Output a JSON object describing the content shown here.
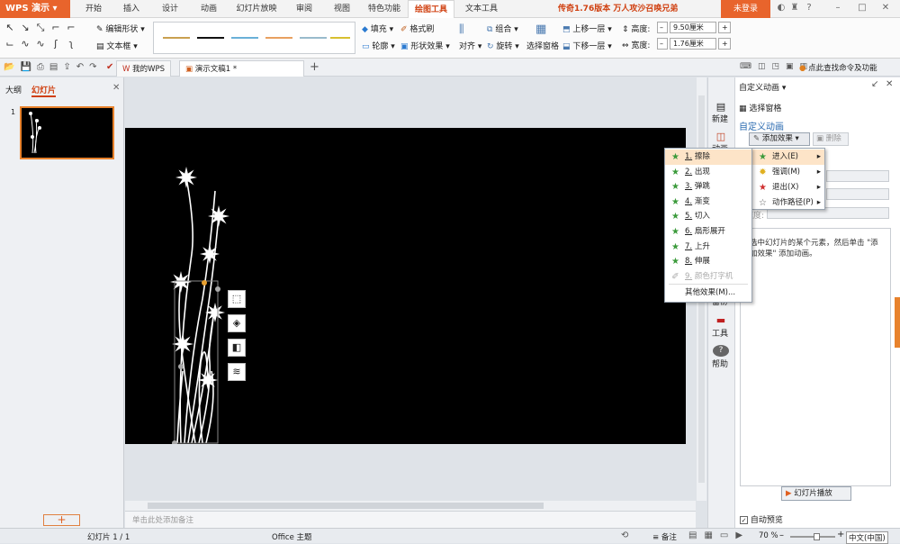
{
  "app": {
    "name": "WPS 演示",
    "login": "未登录"
  },
  "menus": [
    "开始",
    "插入",
    "设计",
    "动画",
    "幻灯片放映",
    "审阅",
    "视图",
    "特色功能",
    "绘图工具",
    "文本工具"
  ],
  "promo": "传奇1.76版本 万人攻沙召唤兄弟",
  "ribbon": {
    "edit_shape": "编辑形状",
    "text_box": "文本框",
    "fill": "填充",
    "format_brush": "格式刷",
    "outline": "轮廓",
    "shape_effect": "形状效果",
    "align": "对齐",
    "group": "组合",
    "rotate": "旋转",
    "select_pane": "选择窗格",
    "bring_forward": "上移一层",
    "send_backward": "下移一层",
    "height_label": "高度:",
    "height_value": "9.50厘米",
    "width_label": "宽度:",
    "width_value": "1.76厘米"
  },
  "tabs": {
    "my_wps": "我的WPS",
    "doc": "演示文稿1 *"
  },
  "search_hint": "点此查找命令及功能",
  "left_panel": {
    "outline": "大纲",
    "slides": "幻灯片",
    "slide_number": "1"
  },
  "strip": {
    "new": "新建",
    "anim": "动画",
    "backup": "备份",
    "tools": "工具",
    "help": "帮助"
  },
  "pane": {
    "title": "自定义动画",
    "select_pane": "选择窗格",
    "section": "自定义动画",
    "add_effect": "添加效果",
    "delete": "删除",
    "speed": "速度:",
    "hint": "选中幻灯片的某个元素，然后单击 \"添加效果\" 添加动画。",
    "play": "幻灯片播放",
    "autopreview": "自动预览"
  },
  "menu_main": [
    {
      "label": "进入(E)"
    },
    {
      "label": "强调(M)"
    },
    {
      "label": "退出(X)"
    },
    {
      "label": "动作路径(P)"
    }
  ],
  "menu_enter": [
    {
      "num": "1.",
      "label": "擦除"
    },
    {
      "num": "2.",
      "label": "出现"
    },
    {
      "num": "3.",
      "label": "弹跳"
    },
    {
      "num": "4.",
      "label": "渐变"
    },
    {
      "num": "5.",
      "label": "切入"
    },
    {
      "num": "6.",
      "label": "扇形展开"
    },
    {
      "num": "7.",
      "label": "上升"
    },
    {
      "num": "8.",
      "label": "伸展"
    },
    {
      "num": "9.",
      "label": "颜色打字机"
    },
    {
      "num": "",
      "label": "其他效果(M)..."
    }
  ],
  "notes_placeholder": "单击此处添加备注",
  "status": {
    "slide": "幻灯片 1 / 1",
    "theme": "Office 主题",
    "notes": "备注",
    "zoom": "70 %",
    "ime": "中文(中国)"
  }
}
